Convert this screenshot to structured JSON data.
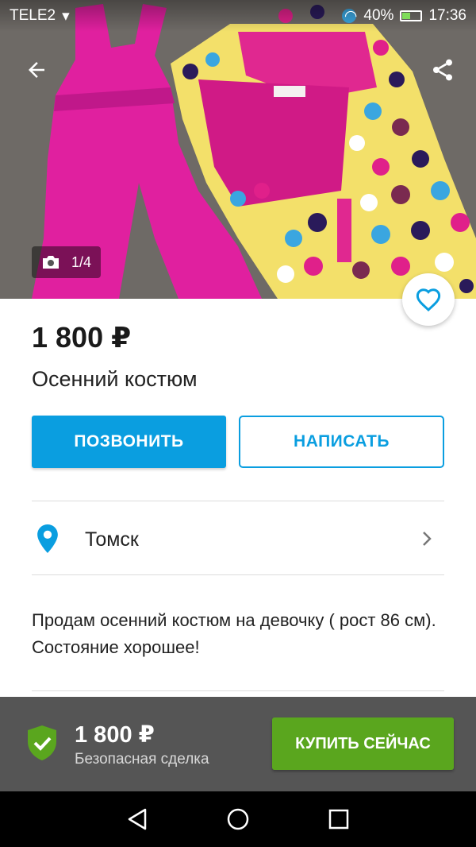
{
  "status_bar": {
    "carrier": "TELE2",
    "battery": "40%",
    "time": "17:36"
  },
  "gallery": {
    "counter": "1/4",
    "icons": [
      "back-arrow-icon",
      "share-icon",
      "camera-icon",
      "heart-icon"
    ]
  },
  "listing": {
    "price": "1 800 ₽",
    "title": "Осенний костюм",
    "location": "Томск",
    "description": "Продам осенний костюм на девочку ( рост 86 см). Состояние хорошее!"
  },
  "actions": {
    "call_label": "ПОЗВОНИТЬ",
    "write_label": "НАПИСАТЬ"
  },
  "buy_bar": {
    "price": "1 800 ₽",
    "subtitle": "Безопасная сделка",
    "buy_label": "КУПИТЬ СЕЙЧАС"
  },
  "colors": {
    "accent_blue": "#0a9ee0",
    "buy_green": "#5aa61e",
    "shield_green": "#5aa61e",
    "buy_bar_bg": "#555555"
  }
}
